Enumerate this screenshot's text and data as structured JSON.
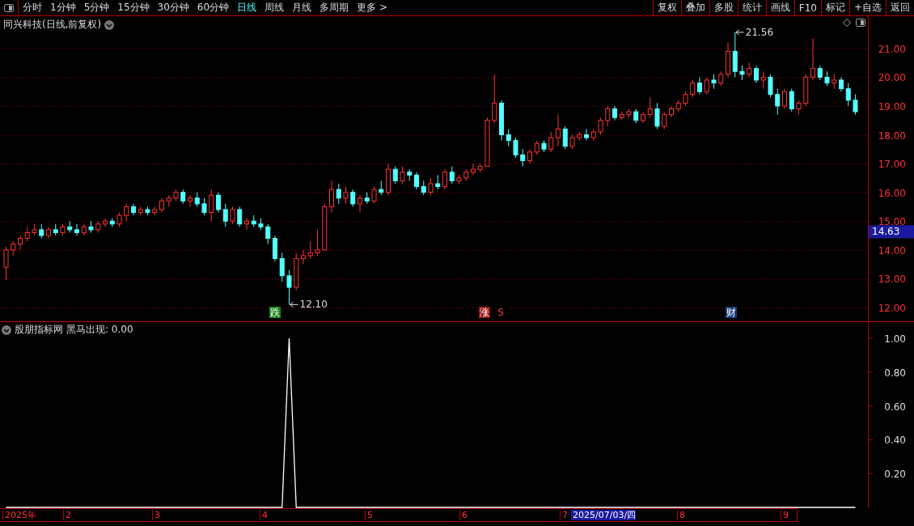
{
  "toolbar": {
    "periods": [
      {
        "label": "分时",
        "selected": false
      },
      {
        "label": "1分钟",
        "selected": false
      },
      {
        "label": "5分钟",
        "selected": false
      },
      {
        "label": "15分钟",
        "selected": false
      },
      {
        "label": "30分钟",
        "selected": false
      },
      {
        "label": "60分钟",
        "selected": false
      },
      {
        "label": "日线",
        "selected": true
      },
      {
        "label": "周线",
        "selected": false
      },
      {
        "label": "月线",
        "selected": false
      },
      {
        "label": "多周期",
        "selected": false
      }
    ],
    "more": "更多 >",
    "tools": [
      "复权",
      "叠加",
      "多股",
      "统计",
      "画线",
      "F10",
      "标记",
      "+自选",
      "返回"
    ]
  },
  "price_chart": {
    "title": "同兴科技(日线,前复权)",
    "chart_data": {
      "type": "candlestick",
      "grid": true,
      "ylim": [
        11.52,
        22.12
      ],
      "yticks": [
        {
          "value": 21,
          "label": "21.00"
        },
        {
          "value": 20,
          "label": "20.00"
        },
        {
          "value": 19,
          "label": "19.00"
        },
        {
          "value": 18,
          "label": "18.00"
        },
        {
          "value": 17,
          "label": "17.00"
        },
        {
          "value": 16,
          "label": "16.00"
        },
        {
          "value": 15,
          "label": "15.00"
        },
        {
          "value": 14,
          "label": "14.00"
        },
        {
          "value": 13,
          "label": "13.00"
        },
        {
          "value": 12,
          "label": "12.00"
        }
      ],
      "ohlc": [
        [
          13.4,
          14.1,
          12.95,
          14.0
        ],
        [
          14.0,
          14.3,
          13.8,
          14.2
        ],
        [
          14.2,
          14.5,
          14.0,
          14.4
        ],
        [
          14.4,
          14.8,
          14.3,
          14.6
        ],
        [
          14.6,
          14.9,
          14.5,
          14.7
        ],
        [
          14.7,
          14.9,
          14.4,
          14.5
        ],
        [
          14.5,
          14.8,
          14.4,
          14.7
        ],
        [
          14.7,
          14.9,
          14.5,
          14.6
        ],
        [
          14.6,
          14.9,
          14.5,
          14.8
        ],
        [
          14.8,
          15.0,
          14.6,
          14.7
        ],
        [
          14.7,
          14.9,
          14.5,
          14.6
        ],
        [
          14.6,
          14.9,
          14.5,
          14.8
        ],
        [
          14.8,
          15.0,
          14.6,
          14.7
        ],
        [
          14.7,
          15.0,
          14.6,
          14.9
        ],
        [
          14.9,
          15.1,
          14.8,
          15.0
        ],
        [
          15.0,
          15.1,
          14.8,
          14.9
        ],
        [
          14.9,
          15.3,
          14.8,
          15.2
        ],
        [
          15.2,
          15.6,
          15.0,
          15.5
        ],
        [
          15.5,
          15.6,
          15.2,
          15.3
        ],
        [
          15.3,
          15.5,
          15.2,
          15.4
        ],
        [
          15.4,
          15.5,
          15.2,
          15.3
        ],
        [
          15.3,
          15.5,
          15.2,
          15.4
        ],
        [
          15.4,
          15.8,
          15.3,
          15.7
        ],
        [
          15.7,
          15.9,
          15.5,
          15.8
        ],
        [
          15.8,
          16.1,
          15.7,
          16.0
        ],
        [
          16.0,
          16.1,
          15.6,
          15.7
        ],
        [
          15.7,
          15.9,
          15.5,
          15.8
        ],
        [
          15.8,
          16.0,
          15.5,
          15.6
        ],
        [
          15.6,
          15.8,
          15.2,
          15.3
        ],
        [
          15.3,
          16.1,
          15.0,
          15.9
        ],
        [
          15.9,
          16.0,
          15.3,
          15.4
        ],
        [
          15.4,
          15.6,
          14.8,
          15.0
        ],
        [
          15.0,
          15.5,
          14.9,
          15.4
        ],
        [
          15.4,
          15.5,
          14.8,
          14.9
        ],
        [
          14.9,
          15.1,
          14.7,
          15.0
        ],
        [
          15.0,
          15.2,
          14.8,
          14.9
        ],
        [
          14.9,
          15.1,
          14.7,
          14.8
        ],
        [
          14.8,
          14.9,
          14.2,
          14.4
        ],
        [
          14.4,
          14.5,
          13.6,
          13.7
        ],
        [
          13.7,
          13.9,
          12.9,
          13.1
        ],
        [
          13.1,
          13.3,
          12.1,
          12.7
        ],
        [
          12.7,
          13.9,
          12.6,
          13.7
        ],
        [
          13.7,
          14.0,
          13.5,
          13.8
        ],
        [
          13.8,
          14.3,
          13.7,
          13.9
        ],
        [
          13.9,
          14.7,
          13.8,
          14.0
        ],
        [
          14.0,
          15.6,
          14.0,
          15.5
        ],
        [
          15.5,
          16.4,
          15.3,
          16.1
        ],
        [
          16.1,
          16.3,
          15.6,
          15.8
        ],
        [
          15.8,
          16.2,
          15.6,
          16.0
        ],
        [
          16.0,
          16.1,
          15.5,
          15.6
        ],
        [
          15.6,
          15.9,
          15.3,
          15.8
        ],
        [
          15.8,
          16.0,
          15.6,
          15.7
        ],
        [
          15.7,
          16.2,
          15.6,
          16.1
        ],
        [
          16.1,
          16.4,
          15.9,
          16.0
        ],
        [
          16.0,
          17.0,
          15.9,
          16.8
        ],
        [
          16.8,
          16.9,
          16.3,
          16.4
        ],
        [
          16.4,
          16.9,
          16.3,
          16.7
        ],
        [
          16.7,
          16.8,
          16.4,
          16.6
        ],
        [
          16.6,
          16.7,
          16.1,
          16.2
        ],
        [
          16.2,
          16.4,
          15.9,
          16.0
        ],
        [
          16.0,
          16.5,
          15.9,
          16.3
        ],
        [
          16.3,
          16.6,
          16.1,
          16.2
        ],
        [
          16.2,
          16.8,
          16.1,
          16.7
        ],
        [
          16.7,
          16.9,
          16.3,
          16.4
        ],
        [
          16.4,
          16.6,
          16.3,
          16.5
        ],
        [
          16.5,
          16.8,
          16.4,
          16.7
        ],
        [
          16.7,
          17.0,
          16.6,
          16.8
        ],
        [
          16.8,
          17.0,
          16.7,
          16.9
        ],
        [
          16.9,
          18.6,
          16.9,
          18.5
        ],
        [
          18.5,
          20.1,
          18.4,
          19.1
        ],
        [
          19.1,
          19.2,
          17.8,
          18.0
        ],
        [
          18.0,
          18.2,
          17.6,
          17.8
        ],
        [
          17.8,
          17.9,
          17.2,
          17.3
        ],
        [
          17.3,
          17.5,
          16.9,
          17.1
        ],
        [
          17.1,
          17.5,
          17.0,
          17.4
        ],
        [
          17.4,
          17.8,
          17.3,
          17.7
        ],
        [
          17.7,
          17.8,
          17.4,
          17.5
        ],
        [
          17.5,
          18.1,
          17.4,
          17.9
        ],
        [
          17.9,
          18.7,
          17.6,
          18.2
        ],
        [
          18.2,
          18.3,
          17.5,
          17.6
        ],
        [
          17.6,
          18.0,
          17.5,
          17.9
        ],
        [
          17.9,
          18.1,
          17.8,
          18.0
        ],
        [
          18.0,
          18.2,
          17.8,
          17.9
        ],
        [
          17.9,
          18.2,
          17.8,
          18.1
        ],
        [
          18.1,
          18.6,
          18.0,
          18.5
        ],
        [
          18.5,
          19.0,
          18.3,
          18.9
        ],
        [
          18.9,
          19.0,
          18.5,
          18.6
        ],
        [
          18.6,
          18.8,
          18.5,
          18.7
        ],
        [
          18.7,
          18.9,
          18.6,
          18.8
        ],
        [
          18.8,
          18.9,
          18.4,
          18.5
        ],
        [
          18.5,
          18.8,
          18.4,
          18.7
        ],
        [
          18.7,
          19.3,
          18.6,
          18.9
        ],
        [
          18.9,
          19.1,
          18.2,
          18.3
        ],
        [
          18.3,
          18.8,
          18.2,
          18.7
        ],
        [
          18.7,
          19.0,
          18.6,
          18.9
        ],
        [
          18.9,
          19.2,
          18.8,
          19.1
        ],
        [
          19.1,
          19.5,
          19.0,
          19.4
        ],
        [
          19.4,
          19.9,
          19.3,
          19.8
        ],
        [
          19.8,
          20.0,
          19.4,
          19.5
        ],
        [
          19.5,
          20.0,
          19.4,
          19.9
        ],
        [
          19.9,
          20.1,
          19.6,
          19.8
        ],
        [
          19.8,
          20.2,
          19.7,
          20.1
        ],
        [
          20.1,
          21.2,
          20.0,
          20.9
        ],
        [
          20.9,
          21.56,
          20.0,
          20.2
        ],
        [
          20.2,
          20.4,
          19.9,
          20.1
        ],
        [
          20.1,
          20.5,
          20.0,
          20.3
        ],
        [
          20.3,
          20.4,
          19.8,
          19.9
        ],
        [
          19.9,
          20.2,
          19.6,
          20.0
        ],
        [
          20.0,
          20.1,
          19.3,
          19.4
        ],
        [
          19.4,
          19.6,
          18.7,
          19.0
        ],
        [
          19.0,
          19.6,
          18.9,
          19.5
        ],
        [
          19.5,
          19.6,
          18.8,
          18.9
        ],
        [
          18.9,
          19.2,
          18.7,
          19.1
        ],
        [
          19.1,
          20.1,
          19.0,
          20.0
        ],
        [
          20.0,
          21.35,
          19.9,
          20.3
        ],
        [
          20.3,
          20.4,
          19.9,
          20.0
        ],
        [
          20.0,
          20.2,
          19.7,
          19.8
        ],
        [
          19.8,
          20.1,
          19.6,
          19.9
        ],
        [
          19.9,
          20.0,
          19.5,
          19.6
        ],
        [
          19.6,
          19.8,
          19.0,
          19.2
        ],
        [
          19.2,
          19.4,
          18.7,
          18.8
        ]
      ]
    },
    "current_price": "14.63",
    "high_marker": "21.56",
    "low_marker": "12.10",
    "signals": [
      {
        "label": "跌",
        "color": "#1a8a1a"
      },
      {
        "label": "涨",
        "color": "#9a1010"
      },
      {
        "label": "S",
        "color": "#000000"
      },
      {
        "label": "财",
        "color": "#1a3a7a"
      }
    ]
  },
  "indicator": {
    "name": "股朋指标网",
    "reading": ": 0.00",
    "chart_data": {
      "type": "line",
      "yticks": [
        {
          "value": 1,
          "label": "1.00"
        },
        {
          "value": 0.8,
          "label": "0.80"
        },
        {
          "value": 0.6,
          "label": "0.60"
        },
        {
          "value": 0.4,
          "label": "0.40"
        },
        {
          "value": 0.2,
          "label": "0.20"
        }
      ],
      "ylim": [
        0,
        1.096
      ],
      "series": [
        {
          "name": "黑马出现",
          "color": "#ffffff",
          "values": [
            0,
            0,
            0,
            0,
            0,
            0,
            0,
            0,
            0,
            0,
            0,
            0,
            0,
            0,
            0,
            0,
            0,
            0,
            0,
            0,
            0,
            0,
            0,
            0,
            0,
            0,
            0,
            0,
            0,
            0,
            0,
            0,
            0,
            0,
            0,
            0,
            0,
            0,
            0,
            0,
            1,
            0,
            0,
            0,
            0,
            0,
            0,
            0,
            0,
            0,
            0,
            0,
            0,
            0,
            0,
            0,
            0,
            0,
            0,
            0,
            0,
            0,
            0,
            0,
            0,
            0,
            0,
            0,
            0,
            0,
            0,
            0,
            0,
            0,
            0,
            0,
            0,
            0,
            0,
            0,
            0,
            0,
            0,
            0,
            0,
            0,
            0,
            0,
            0,
            0,
            0,
            0,
            0,
            0,
            0,
            0,
            0,
            0,
            0,
            0,
            0,
            0,
            0,
            0,
            0,
            0,
            0,
            0,
            0,
            0,
            0,
            0,
            0,
            0,
            0,
            0,
            0,
            0,
            0,
            0,
            0
          ]
        }
      ]
    }
  },
  "time_axis": [
    {
      "label": "2025年",
      "highlighted": false
    },
    {
      "label": "2",
      "highlighted": false
    },
    {
      "label": "3",
      "highlighted": false
    },
    {
      "label": "4",
      "highlighted": false
    },
    {
      "label": "5",
      "highlighted": false
    },
    {
      "label": "6",
      "highlighted": false
    },
    {
      "label": "7",
      "highlighted": false
    },
    {
      "label": "2025/07/03/四",
      "highlighted": true
    },
    {
      "label": "8",
      "highlighted": false
    },
    {
      "label": "9",
      "highlighted": false
    }
  ]
}
